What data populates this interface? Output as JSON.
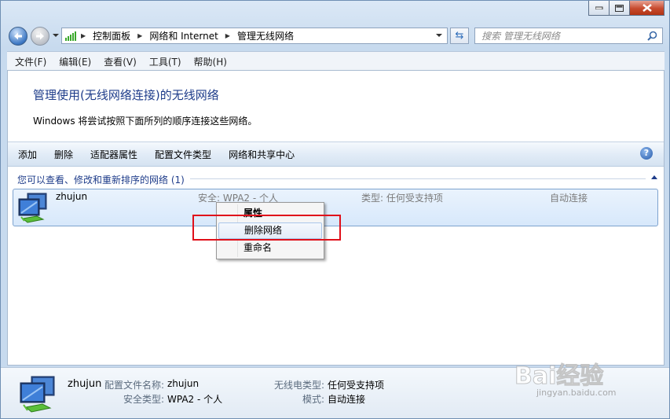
{
  "breadcrumb": [
    "控制面板",
    "网络和 Internet",
    "管理无线网络"
  ],
  "search": {
    "placeholder": "搜索 管理无线网络"
  },
  "menu": [
    "文件(F)",
    "编辑(E)",
    "查看(V)",
    "工具(T)",
    "帮助(H)"
  ],
  "heading": "管理使用(无线网络连接)的无线网络",
  "description": "Windows 将尝试按照下面所列的顺序连接这些网络。",
  "toolbar": [
    "添加",
    "删除",
    "适配器属性",
    "配置文件类型",
    "网络和共享中心"
  ],
  "group_title": "您可以查看、修改和重新排序的网络 (1)",
  "network": {
    "name": "zhujun",
    "security": "安全: WPA2 - 个人",
    "type": "类型: 任何受支持项",
    "mode": "自动连接"
  },
  "context_menu": [
    "属性",
    "删除网络",
    "重命名"
  ],
  "details": {
    "name": "zhujun",
    "profile_label": "配置文件名称:",
    "profile_value": "zhujun",
    "security_label": "安全类型:",
    "security_value": "WPA2 - 个人",
    "radio_label": "无线电类型:",
    "radio_value": "任何受支持项",
    "mode_label": "模式:",
    "mode_value": "自动连接"
  },
  "watermark": {
    "brand": "Bai经验",
    "url": "jingyan.baidu.com"
  }
}
